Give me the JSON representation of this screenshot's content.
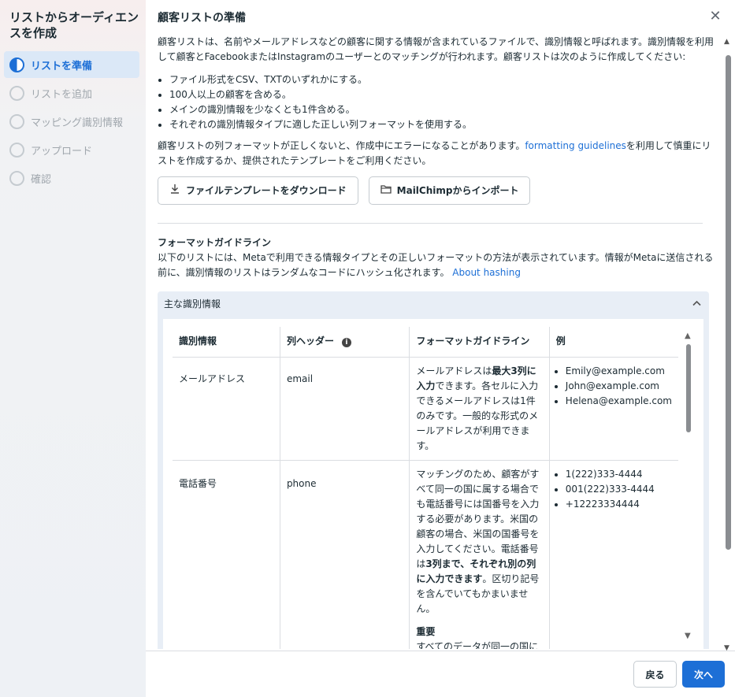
{
  "sidebar": {
    "title": "リストからオーディエンスを作成",
    "steps": [
      {
        "label": "リストを準備",
        "active": true
      },
      {
        "label": "リストを追加",
        "active": false
      },
      {
        "label": "マッピング識別情報",
        "active": false
      },
      {
        "label": "アップロード",
        "active": false
      },
      {
        "label": "確認",
        "active": false
      }
    ]
  },
  "header": {
    "title": "顧客リストの準備",
    "close_icon": "close-icon"
  },
  "intro": {
    "paragraph": "顧客リストは、名前やメールアドレスなどの顧客に関する情報が含まれているファイルで、識別情報と呼ばれます。識別情報を利用して顧客とFacebookまたはInstagramのユーザーとのマッチングが行われます。顧客リストは次のように作成してください:",
    "bullets": [
      "ファイル形式をCSV、TXTのいずれかにする。",
      "100人以上の顧客を含める。",
      "メインの識別情報を少なくとも1件含める。",
      "それぞれの識別情報タイプに適した正しい列フォーマットを使用する。"
    ],
    "warn_before": "顧客リストの列フォーマットが正しくないと、作成中にエラーになることがあります。",
    "warn_link": "formatting guidelines",
    "warn_after": "を利用して慎重にリストを作成するか、提供されたテンプレートをご利用ください。"
  },
  "buttons": {
    "download_label": "ファイルテンプレートをダウンロード",
    "download_icon": "download-icon",
    "import_label": "MailChimpからインポート",
    "import_icon": "folder-icon"
  },
  "format_section": {
    "title": "フォーマットガイドライン",
    "text": "以下のリストには、Metaで利用できる情報タイプとその正しいフォーマットの方法が表示されています。情報がMetaに送信される前に、識別情報のリストはランダムなコードにハッシュ化されます。",
    "link": "About hashing"
  },
  "accordion": {
    "title": "主な識別情報",
    "chevron_icon": "chevron-up-icon"
  },
  "table": {
    "headers": [
      "識別情報",
      "列ヘッダー",
      "フォーマットガイドライン",
      "例"
    ],
    "rows": [
      {
        "identifier": "メールアドレス",
        "column": "email",
        "guide_a": "メールアドレスは",
        "guide_b": "最大3列に入力",
        "guide_c": "できます。各セルに入力できるメールアドレスは1件のみです。一般的な形式のメールアドレスが利用できます。",
        "examples": [
          "Emily@example.com",
          "John@example.com",
          "Helena@example.com"
        ]
      },
      {
        "identifier": "電話番号",
        "column": "phone",
        "guide_a": "マッチングのため、顧客がすべて同一の国に属する場合でも電話番号には国番号を入力する必要があります。米国の顧客の場合、米国の国番号を入力してください。電話番号は",
        "guide_b": "3列まで、それぞれ別の列に入力できます",
        "guide_c": "。区切り記号を含んでいてもかまいません。",
        "important_title": "重要",
        "important_text": "すべてのデータが同一の国に属する場合でも、顧客の電話番号の一部に国番号を含めるようにし",
        "examples": [
          "1(222)333-4444",
          "001(222)333-4444",
          "+12223334444"
        ]
      }
    ]
  },
  "footer": {
    "back_label": "戻る",
    "next_label": "次へ"
  },
  "colors": {
    "accent": "#1d6fd6",
    "sidebar_active_bg": "#dbe8f7",
    "accordion_bg": "#e8eef6"
  }
}
